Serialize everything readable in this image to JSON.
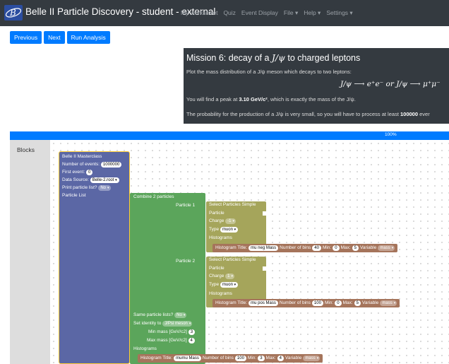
{
  "navbar": {
    "title": "Belle II Particle Discovery - student - external",
    "links": [
      "My worksheet",
      "Quiz",
      "Event Display",
      "File ▾",
      "Help ▾",
      "Settings ▾"
    ]
  },
  "toolbar": {
    "previous": "Previous",
    "next": "Next",
    "run": "Run Analysis"
  },
  "mission": {
    "title_prefix": "Mission 6: decay of a ",
    "title_particle": "J/ψ",
    "title_suffix": " to charged leptons",
    "line1": "Plot the mass distribution of a J/ψ meson which decays to two leptons:",
    "equation": "J/ψ ⟶ e⁺e⁻   or   J/ψ ⟶ μ⁺μ⁻",
    "line2_prefix": "You will find a peak at ",
    "line2_value": "3.10 GeV/c²",
    "line2_suffix": ", which is exactly the mass of the J/ψ.",
    "line3_prefix": "The probability for the production of a J/ψ is very small, so you will have to process at least ",
    "line3_value": "100000",
    "line3_suffix": " ever"
  },
  "progress": {
    "label": "100%",
    "fraction": 1.0
  },
  "toolbox": {
    "label": "Blocks"
  },
  "master": {
    "title": "Belle II Masterclass",
    "events_label": "Number of events:",
    "events_value": "1000000",
    "first_label": "First event:",
    "first_value": "0",
    "source_label": "Data Source:",
    "source_value": "Belle-2.root",
    "print_label": "Print particle list?",
    "print_value": "No",
    "list_label": "Particle List"
  },
  "combine": {
    "title": "Combine 2 particles",
    "p1_label": "Particle 1",
    "p2_label": "Particle 2",
    "same_label": "Same particle lists?",
    "same_value": "No",
    "identity_label": "Set identity to",
    "identity_value": "J/Psi meson",
    "min_label": "Min mass [GeV/c2]",
    "min_value": "3",
    "max_label": "Max mass [GeV/c2]",
    "max_value": "4",
    "hist_label": "Histograms",
    "hist": {
      "title_label": "Histogram Title:",
      "title_value": "mumu Mass",
      "bins_label": "Number of bins",
      "bins_value": "100",
      "min_label": "Min:",
      "min_value": "3",
      "max_label": "Max:",
      "max_value": "4",
      "var_label": "Variable",
      "var_value": "mass"
    }
  },
  "select1": {
    "title": "Select Particles Simple",
    "particle": "Particle",
    "charge_label": "Charge",
    "charge_value": "-1",
    "type_label": "Type",
    "type_value": "muon",
    "hist_label": "Histograms",
    "hist": {
      "title_label": "Histogram Title:",
      "title_value": "mu neg Mass",
      "bins_label": "Number of bins",
      "bins_value": "40",
      "min_label": "Min:",
      "min_value": "0",
      "max_label": "Max:",
      "max_value": "5",
      "var_label": "Variable",
      "var_value": "mass"
    }
  },
  "select2": {
    "title": "Select Particles Simple",
    "particle": "Particle",
    "charge_label": "Charge",
    "charge_value": "1",
    "type_label": "Type",
    "type_value": "muon",
    "hist_label": "Histograms",
    "hist": {
      "title_label": "Histogram Title:",
      "title_value": "mu pos Mass",
      "bins_label": "Number of bins",
      "bins_value": "100",
      "min_label": "Min:",
      "min_value": "0",
      "max_label": "Max:",
      "max_value": "5",
      "var_label": "Variable",
      "var_value": "mass"
    }
  },
  "colors": {
    "navbar": "#343a40",
    "primary": "#007bff",
    "master_block": "#5b67a5",
    "combine_block": "#5ba55b",
    "select_block": "#a5a55b",
    "histogram_block": "#a5745b"
  }
}
